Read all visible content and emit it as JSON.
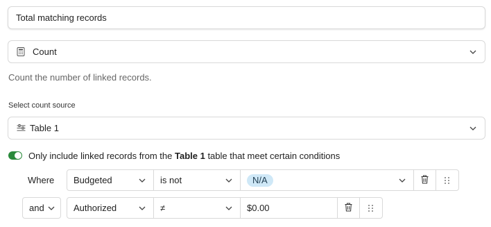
{
  "name_field": {
    "value": "Total matching records"
  },
  "type_select": {
    "icon": "calculator-icon",
    "value": "Count"
  },
  "helper_text": "Count the number of linked records.",
  "count_source": {
    "label": "Select count source",
    "icon": "table-filter-icon",
    "value": "Table 1"
  },
  "filter_toggle": {
    "enabled": true,
    "text_before": "Only include linked records from the ",
    "table_name": "Table 1",
    "text_after": " table that meet certain conditions"
  },
  "conditions": [
    {
      "conjunction": "Where",
      "field": "Budgeted",
      "operator": "is not",
      "value": "N/A"
    },
    {
      "conjunction": "and",
      "field": "Authorized",
      "operator": "≠",
      "value": "$0.00"
    }
  ],
  "colors": {
    "accent_green": "#2a8a3b",
    "pill_blue": "#cfe8f7"
  }
}
